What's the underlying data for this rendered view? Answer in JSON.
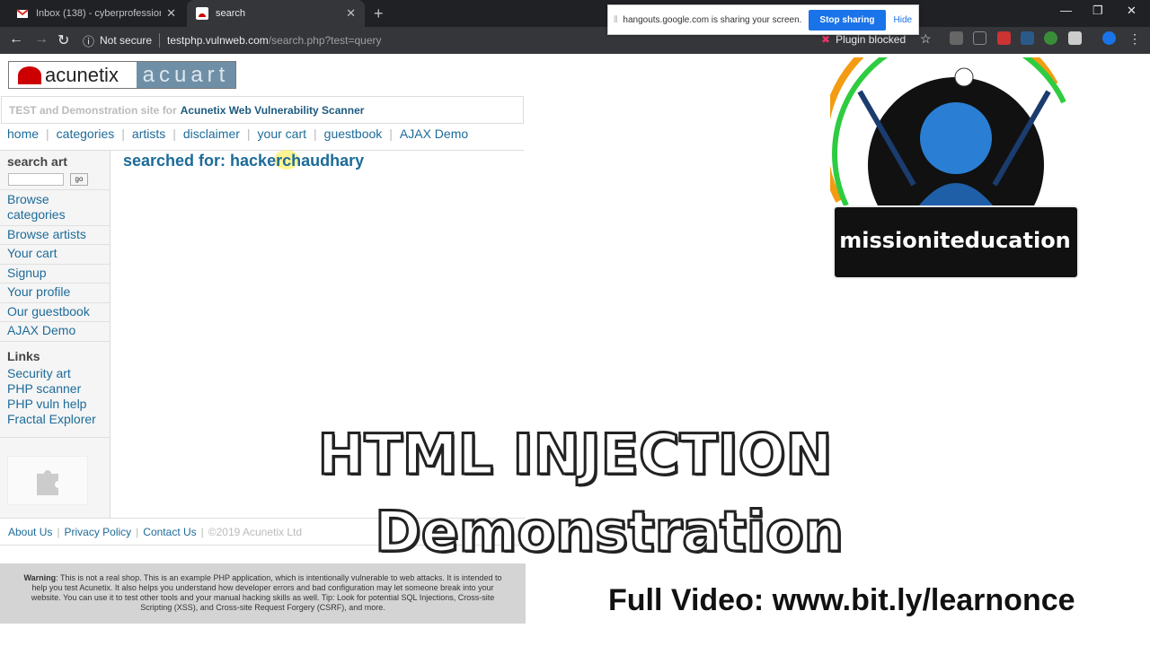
{
  "browser": {
    "tabs": [
      {
        "title": "Inbox (138) - cyberprofessionalp...",
        "icon": "gmail-icon",
        "active": false
      },
      {
        "title": "search",
        "icon": "acunetix-icon",
        "active": true
      }
    ],
    "url_security": "Not secure",
    "url_host": "testphp.vulnweb.com",
    "url_path": "/search.php?test=query",
    "plugin_blocked": "Plugin blocked"
  },
  "share_notice": {
    "text": "hangouts.google.com is sharing your screen.",
    "stop_label": "Stop sharing",
    "hide_label": "Hide"
  },
  "site": {
    "logo_left": "acunetix",
    "logo_right": "acuart",
    "tagline_prefix": "TEST and Demonstration site for",
    "tagline_brand": "Acunetix Web Vulnerability Scanner",
    "nav": [
      "home",
      "categories",
      "artists",
      "disclaimer",
      "your cart",
      "guestbook",
      "AJAX Demo"
    ],
    "search_heading": "search art",
    "search_go": "go",
    "menu": [
      "Browse categories",
      "Browse artists",
      "Your cart",
      "Signup",
      "Your profile",
      "Our guestbook",
      "AJAX Demo"
    ],
    "links_heading": "Links",
    "links": [
      "Security art",
      "PHP scanner",
      "PHP vuln help",
      "Fractal Explorer"
    ],
    "result": "searched for: hackerchaudhary",
    "footer_links": [
      "About Us",
      "Privacy Policy",
      "Contact Us"
    ],
    "copyright": "©2019 Acunetix Ltd",
    "warning_label": "Warning",
    "warning_text": ": This is not a real shop. This is an example PHP application, which is intentionally vulnerable to web attacks. It is intended to help you test Acunetix. It also helps you understand how developer errors and bad configuration may let someone break into your website. You can use it to test other tools and your manual hacking skills as well. Tip: Look for potential SQL Injections, Cross-site Scripting (XSS), and Cross-site Request Forgery (CSRF), and more."
  },
  "overlay": {
    "title_line1": "HTML INJECTION",
    "title_line2": "Demonstration",
    "link": "Full Video: www.bit.ly/learnonce",
    "brand": "missioniteducation"
  }
}
